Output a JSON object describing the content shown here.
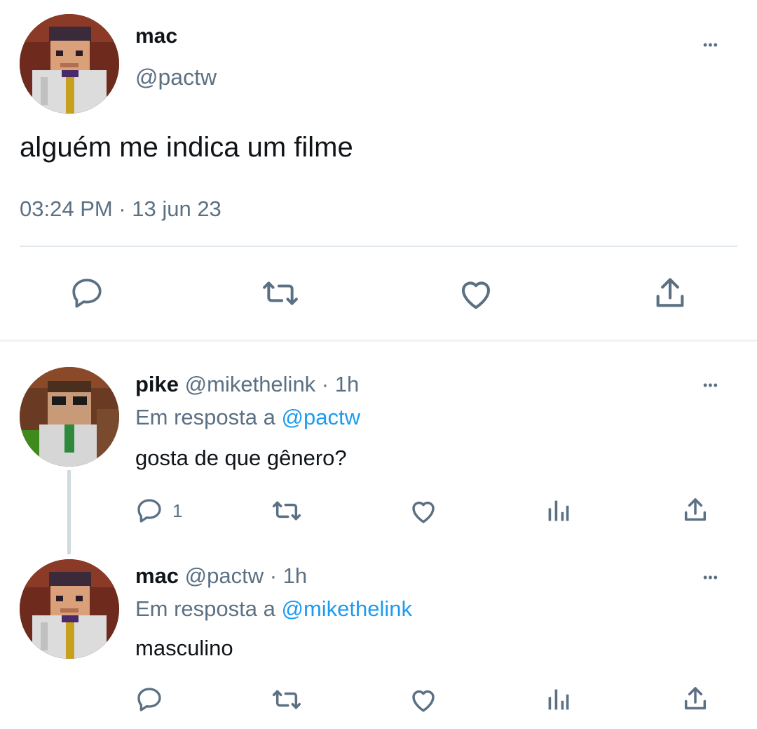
{
  "main_tweet": {
    "author_name": "mac",
    "author_handle": "@pactw",
    "text": "alguém me indica um filme",
    "timestamp": "03:24 PM · 13 jun 23",
    "more_label": "•••"
  },
  "replies": [
    {
      "author_name": "pike",
      "meta": "@mikethelink · 1h",
      "reply_prefix": "Em resposta a",
      "reply_to": "@pactw",
      "text": "gosta de que gênero?",
      "reply_count": "1",
      "more_label": "•••"
    },
    {
      "author_name": "mac",
      "meta": "@pactw · 1h",
      "reply_prefix": "Em resposta a",
      "reply_to": "@mikethelink",
      "text": "masculino",
      "reply_count": "",
      "more_label": "•••"
    }
  ],
  "icons": [
    "reply-icon",
    "retweet-icon",
    "like-icon",
    "analytics-icon",
    "share-icon"
  ],
  "colors": {
    "text": "#0f1419",
    "muted": "#5b7083",
    "link": "#1d9bf0",
    "divider": "#e1e8ed"
  }
}
